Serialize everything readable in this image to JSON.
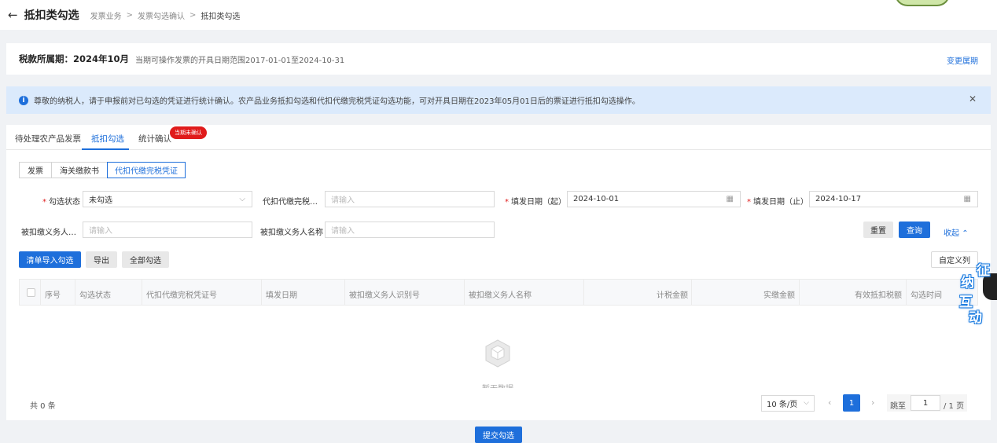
{
  "header": {
    "title": "抵扣类勾选",
    "breadcrumb": [
      "发票业务",
      "发票勾选确认",
      "抵扣类勾选"
    ]
  },
  "period": {
    "label": "税款所属期：2024年10月",
    "range_text": "当期可操作发票的开具日期范围2017-01-01至2024-10-31",
    "change_link": "变更属期"
  },
  "notice": {
    "text": "尊敬的纳税人，请于申报前对已勾选的凭证进行统计确认。农产品业务抵扣勾选和代扣代缴完税凭证勾选功能，可对开具日期在2023年05月01日后的票证进行抵扣勾选操作。"
  },
  "tabs": [
    {
      "label": "待处理农产品发票"
    },
    {
      "label": "抵扣勾选"
    },
    {
      "label": "统计确认"
    }
  ],
  "tab_badge": "当期未确认",
  "doc_types": [
    "发票",
    "海关缴款书",
    "代扣代缴完税凭证"
  ],
  "filters": {
    "status_label": "勾选状态",
    "status_value": "未勾选",
    "voucher_label": "代扣代缴完税凭...",
    "start_label": "填发日期（起）",
    "start_value": "2024-10-01",
    "end_label": "填发日期（止）",
    "end_value": "2024-10-17",
    "taxpayer_id_label": "被扣缴义务人识...",
    "taxpayer_name_label": "被扣缴义务人名称",
    "placeholder": "请输入"
  },
  "actions": {
    "reset": "重置",
    "query": "查询",
    "collapse": "收起",
    "import_select": "清单导入勾选",
    "export": "导出",
    "select_all": "全部勾选",
    "customize": "自定义列"
  },
  "table": {
    "columns": [
      "序号",
      "勾选状态",
      "代扣代缴完税凭证号",
      "填发日期",
      "被扣缴义务人识别号",
      "被扣缴义务人名称",
      "计税金额",
      "实缴金额",
      "有效抵扣税额",
      "勾选时间"
    ],
    "empty_text": "暂无数据"
  },
  "pagination": {
    "total": "共 0 条",
    "page_size": "10 条/页",
    "current": "1",
    "jump_label": "跳至",
    "jump_value": "1",
    "page_total": "/ 1 页"
  },
  "submit": "提交勾选",
  "float_widget": [
    "征",
    "纳",
    "互",
    "动"
  ],
  "colors": {
    "primary": "#1e6fdb",
    "badge": "#e01b1b",
    "notice_bg": "#dbeafc"
  }
}
